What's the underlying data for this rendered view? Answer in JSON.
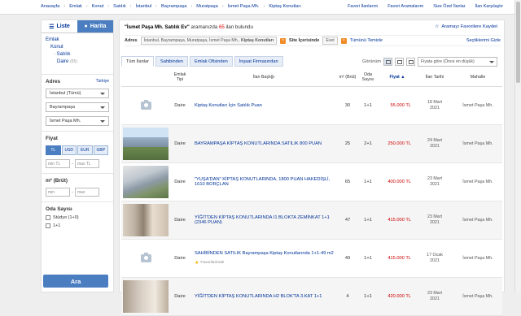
{
  "topbar": {
    "breadcrumbs": [
      "Anasayfa",
      "Emlak",
      "Konut",
      "Satılık",
      "İstanbul",
      "Bayrampaşa",
      "Muratpaşa",
      "İsmet Paşa Mh.",
      "Kiptaş Konutları"
    ],
    "links": [
      "Favori İlanlarım",
      "Favori Aramalarım",
      "Size Özel İlanlar",
      "İlan Karşılaştır"
    ]
  },
  "sidebar": {
    "list_tab": "Liste",
    "map_tab": "Harita",
    "categories": {
      "l1": "Emlak",
      "l2": "Konut",
      "l3": "Satılık",
      "l4": "Daire",
      "l4_count": "(65)"
    },
    "address": {
      "title": "Adres",
      "country": "Türkiye",
      "city": "İstanbul (Tümü)",
      "district": "Bayrampaşa",
      "neighborhood": "İsmet Paşa Mh."
    },
    "price": {
      "title": "Fiyat",
      "currencies": [
        "TL",
        "USD",
        "EUR",
        "GBP"
      ],
      "active_currency": "TL",
      "min_placeholder": "min TL",
      "max_placeholder": "max TL"
    },
    "area": {
      "title": "m² (Brüt)",
      "min_placeholder": "min",
      "max_placeholder": "max"
    },
    "rooms": {
      "title": "Oda Sayısı",
      "options": [
        "Stüdyo (1+0)",
        "1+1"
      ]
    },
    "search_button": "Ara"
  },
  "main": {
    "result_query": "\"İsmet Paşa Mh. Satılık Ev\"",
    "result_text": " aramanızda ",
    "result_count": "65",
    "result_suffix": " ilan bulundu",
    "save_search": "Aramayı Favorilere Kaydet",
    "filters": {
      "address_label": "Adres",
      "address_value": "İstanbul, Bayrampaşa, Muratpaşa, İsmet Paşa Mh., ",
      "address_bold": "Kiptaş Konutları",
      "site_label": "Site İçerisinde",
      "site_value": "Evet",
      "clear_all": "Tümünü Temizle",
      "selected_show": "Seçtiklerimi Gizle"
    },
    "tabs": [
      "Tüm İlanlar",
      "Sahibinden",
      "Emlak Ofisinden",
      "İnşaat Firmasından"
    ],
    "view_label": "Görünüm",
    "sort_value": "Fiyata göre (Önce en düşük)",
    "columns": {
      "type": "Emlak Tipi",
      "title": "İlan Başlığı",
      "area": "m² (Brüt)",
      "rooms": "Oda Sayısı",
      "price": "Fiyat",
      "date": "İlan Tarihi",
      "hood": "Mahalle"
    },
    "listings": [
      {
        "type": "Daire",
        "title": "Kiptaş Konutları İçin Satılık Puan",
        "area": "30",
        "rooms": "1+1",
        "price": "55.000 TL",
        "date1": "18 Mart",
        "date2": "2021",
        "hood": "İsmet Paşa Mh.",
        "image": "none",
        "favorite": ""
      },
      {
        "type": "Daire",
        "title": "BAYRAMPAŞA KİPTAŞ KONUTLARINDA SATILIK 800 PUAN",
        "area": "25",
        "rooms": "2+1",
        "price": "250.000 TL",
        "date1": "24 Mart",
        "date2": "2021",
        "hood": "İsmet Paşa Mh.",
        "image": "photo1",
        "favorite": ""
      },
      {
        "type": "Daire",
        "title": "\"YUŞA'DAN\" KİPTAŞ KONUTLARINDA, 1800 PUAN HAKEDİŞLİ, 1610 BORÇLAN",
        "area": "65",
        "rooms": "1+1",
        "price": "400.000 TL",
        "date1": "23 Mart",
        "date2": "2021",
        "hood": "İsmet Paşa Mh.",
        "image": "photo2",
        "favorite": ""
      },
      {
        "type": "Daire",
        "title": "YİĞİT'DEN KİPTAŞ KONUTLARINDA I1 BLOKTA ZEMİNKAT 1+1 (2346 PUAN)",
        "area": "47",
        "rooms": "1+1",
        "price": "415.000 TL",
        "date1": "23 Mart",
        "date2": "2021",
        "hood": "İsmet Paşa Mh.",
        "image": "photo3",
        "favorite": ""
      },
      {
        "type": "Daire",
        "title": "SAHİBİNDEN SATILIK Bayrampaşa Kiptaş Konutlarında 1+1-49 m2",
        "area": "49",
        "rooms": "1+1",
        "price": "415.000 TL",
        "date1": "17 Ocak",
        "date2": "2021",
        "hood": "İsmet Paşa Mh.",
        "image": "none",
        "favorite": "Favorilerimde"
      },
      {
        "type": "Daire",
        "title": "YİĞİT'DEN KİPTAŞ KONUTLARINDA H2 BLOK'TA 3.KAT 1+1",
        "area": "4",
        "rooms": "1+1",
        "price": "420.000 TL",
        "date1": "23 Mart",
        "date2": "2021",
        "hood": "İsmet Paşa Mh.",
        "image": "photo4",
        "favorite": ""
      }
    ]
  }
}
